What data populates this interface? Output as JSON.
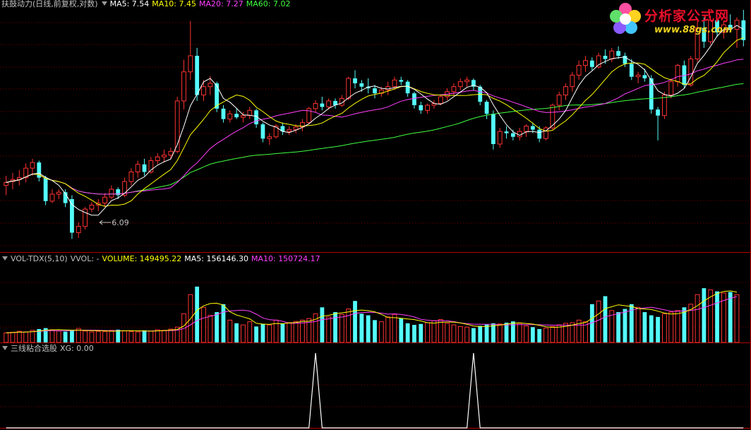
{
  "panels": {
    "main": {
      "title": "扶鼓动力(日线,前复权,对数)",
      "indicators": [
        {
          "label": "MA5: 7.54",
          "color": "#ffffff"
        },
        {
          "label": "MA10: 7.45",
          "color": "#ffff00"
        },
        {
          "label": "MA20: 7.27",
          "color": "#ff40ff"
        },
        {
          "label": "MA60: 7.02",
          "color": "#40ff40"
        }
      ]
    },
    "volume": {
      "title": "VOL-TDX(5,10)",
      "indicators": [
        {
          "label": "VVOL: -",
          "color": "#c0c0c0"
        },
        {
          "label": "VOLUME: 149495.22",
          "color": "#ffff00"
        },
        {
          "label": "MA5: 156146.30",
          "color": "#ffffff"
        },
        {
          "label": "MA10: 150724.17",
          "color": "#ff40ff"
        }
      ]
    },
    "signal": {
      "title": "三线粘合选股",
      "indicators": [
        {
          "label": "XG: 0.00",
          "color": "#c0c0c0"
        }
      ]
    }
  },
  "logo": {
    "brand": "分析家公式网",
    "url": "www.88gs.com"
  },
  "colors": {
    "up": "#ff3232",
    "down": "#54fcfc",
    "ma5": "#ffffff",
    "ma10": "#ffff00",
    "ma20": "#ff40ff",
    "ma60": "#40ff40",
    "grid": "#7a0000"
  },
  "chart_data": {
    "type": "candlestick",
    "annotation": {
      "text": "6.09",
      "candle_index": 14
    },
    "price_range": [
      6.0,
      8.7
    ],
    "candles": [
      {
        "o": 6.62,
        "h": 6.72,
        "l": 6.52,
        "c": 6.65
      },
      {
        "o": 6.66,
        "h": 6.75,
        "l": 6.58,
        "c": 6.68
      },
      {
        "o": 6.68,
        "h": 6.78,
        "l": 6.62,
        "c": 6.7
      },
      {
        "o": 6.7,
        "h": 6.85,
        "l": 6.65,
        "c": 6.8
      },
      {
        "o": 6.8,
        "h": 6.9,
        "l": 6.72,
        "c": 6.86
      },
      {
        "o": 6.86,
        "h": 6.88,
        "l": 6.66,
        "c": 6.7
      },
      {
        "o": 6.7,
        "h": 6.72,
        "l": 6.42,
        "c": 6.46
      },
      {
        "o": 6.46,
        "h": 6.58,
        "l": 6.44,
        "c": 6.53
      },
      {
        "o": 6.53,
        "h": 6.58,
        "l": 6.48,
        "c": 6.55
      },
      {
        "o": 6.55,
        "h": 6.58,
        "l": 6.4,
        "c": 6.44
      },
      {
        "o": 6.48,
        "h": 6.52,
        "l": 6.09,
        "c": 6.15
      },
      {
        "o": 6.15,
        "h": 6.25,
        "l": 6.1,
        "c": 6.21
      },
      {
        "o": 6.21,
        "h": 6.4,
        "l": 6.18,
        "c": 6.38
      },
      {
        "o": 6.38,
        "h": 6.45,
        "l": 6.35,
        "c": 6.42
      },
      {
        "o": 6.42,
        "h": 6.48,
        "l": 6.36,
        "c": 6.44
      },
      {
        "o": 6.44,
        "h": 6.54,
        "l": 6.4,
        "c": 6.5
      },
      {
        "o": 6.5,
        "h": 6.62,
        "l": 6.48,
        "c": 6.58
      },
      {
        "o": 6.58,
        "h": 6.6,
        "l": 6.48,
        "c": 6.52
      },
      {
        "o": 6.52,
        "h": 6.7,
        "l": 6.5,
        "c": 6.66
      },
      {
        "o": 6.66,
        "h": 6.8,
        "l": 6.62,
        "c": 6.76
      },
      {
        "o": 6.76,
        "h": 6.88,
        "l": 6.7,
        "c": 6.84
      },
      {
        "o": 6.84,
        "h": 6.9,
        "l": 6.72,
        "c": 6.76
      },
      {
        "o": 6.76,
        "h": 6.92,
        "l": 6.74,
        "c": 6.88
      },
      {
        "o": 6.88,
        "h": 6.96,
        "l": 6.84,
        "c": 6.92
      },
      {
        "o": 6.92,
        "h": 7.0,
        "l": 6.86,
        "c": 6.94
      },
      {
        "o": 6.94,
        "h": 7.02,
        "l": 6.9,
        "c": 6.98
      },
      {
        "o": 6.98,
        "h": 7.6,
        "l": 6.96,
        "c": 7.55
      },
      {
        "o": 7.55,
        "h": 8.05,
        "l": 7.45,
        "c": 7.9
      },
      {
        "o": 7.9,
        "h": 8.55,
        "l": 7.8,
        "c": 8.1
      },
      {
        "o": 8.1,
        "h": 8.2,
        "l": 7.55,
        "c": 7.62
      },
      {
        "o": 7.62,
        "h": 7.8,
        "l": 7.55,
        "c": 7.72
      },
      {
        "o": 7.72,
        "h": 7.85,
        "l": 7.62,
        "c": 7.76
      },
      {
        "o": 7.76,
        "h": 7.78,
        "l": 7.42,
        "c": 7.46
      },
      {
        "o": 7.46,
        "h": 7.5,
        "l": 7.3,
        "c": 7.34
      },
      {
        "o": 7.34,
        "h": 7.44,
        "l": 7.3,
        "c": 7.4
      },
      {
        "o": 7.4,
        "h": 7.46,
        "l": 7.34,
        "c": 7.36
      },
      {
        "o": 7.36,
        "h": 7.42,
        "l": 7.3,
        "c": 7.38
      },
      {
        "o": 7.38,
        "h": 7.48,
        "l": 7.34,
        "c": 7.44
      },
      {
        "o": 7.44,
        "h": 7.46,
        "l": 7.24,
        "c": 7.28
      },
      {
        "o": 7.28,
        "h": 7.3,
        "l": 7.08,
        "c": 7.12
      },
      {
        "o": 7.12,
        "h": 7.18,
        "l": 7.05,
        "c": 7.14
      },
      {
        "o": 7.14,
        "h": 7.28,
        "l": 7.12,
        "c": 7.26
      },
      {
        "o": 7.26,
        "h": 7.3,
        "l": 7.16,
        "c": 7.2
      },
      {
        "o": 7.2,
        "h": 7.26,
        "l": 7.16,
        "c": 7.22
      },
      {
        "o": 7.22,
        "h": 7.28,
        "l": 7.18,
        "c": 7.25
      },
      {
        "o": 7.25,
        "h": 7.34,
        "l": 7.2,
        "c": 7.3
      },
      {
        "o": 7.3,
        "h": 7.48,
        "l": 7.28,
        "c": 7.46
      },
      {
        "o": 7.46,
        "h": 7.56,
        "l": 7.42,
        "c": 7.52
      },
      {
        "o": 7.52,
        "h": 7.6,
        "l": 7.44,
        "c": 7.48
      },
      {
        "o": 7.48,
        "h": 7.58,
        "l": 7.45,
        "c": 7.55
      },
      {
        "o": 7.55,
        "h": 7.58,
        "l": 7.46,
        "c": 7.5
      },
      {
        "o": 7.5,
        "h": 7.62,
        "l": 7.48,
        "c": 7.58
      },
      {
        "o": 7.58,
        "h": 7.84,
        "l": 7.56,
        "c": 7.82
      },
      {
        "o": 7.82,
        "h": 7.92,
        "l": 7.7,
        "c": 7.76
      },
      {
        "o": 7.76,
        "h": 7.8,
        "l": 7.66,
        "c": 7.72
      },
      {
        "o": 7.72,
        "h": 7.82,
        "l": 7.64,
        "c": 7.7
      },
      {
        "o": 7.7,
        "h": 7.74,
        "l": 7.58,
        "c": 7.64
      },
      {
        "o": 7.64,
        "h": 7.72,
        "l": 7.6,
        "c": 7.68
      },
      {
        "o": 7.68,
        "h": 7.78,
        "l": 7.62,
        "c": 7.72
      },
      {
        "o": 7.72,
        "h": 7.84,
        "l": 7.68,
        "c": 7.8
      },
      {
        "o": 7.8,
        "h": 7.84,
        "l": 7.74,
        "c": 7.78
      },
      {
        "o": 7.78,
        "h": 7.8,
        "l": 7.6,
        "c": 7.64
      },
      {
        "o": 7.64,
        "h": 7.66,
        "l": 7.46,
        "c": 7.5
      },
      {
        "o": 7.5,
        "h": 7.54,
        "l": 7.4,
        "c": 7.44
      },
      {
        "o": 7.44,
        "h": 7.52,
        "l": 7.4,
        "c": 7.5
      },
      {
        "o": 7.5,
        "h": 7.56,
        "l": 7.46,
        "c": 7.52
      },
      {
        "o": 7.52,
        "h": 7.62,
        "l": 7.5,
        "c": 7.6
      },
      {
        "o": 7.6,
        "h": 7.7,
        "l": 7.56,
        "c": 7.66
      },
      {
        "o": 7.66,
        "h": 7.76,
        "l": 7.62,
        "c": 7.72
      },
      {
        "o": 7.72,
        "h": 7.82,
        "l": 7.68,
        "c": 7.78
      },
      {
        "o": 7.78,
        "h": 7.84,
        "l": 7.72,
        "c": 7.8
      },
      {
        "o": 7.8,
        "h": 7.82,
        "l": 7.68,
        "c": 7.72
      },
      {
        "o": 7.72,
        "h": 7.74,
        "l": 7.5,
        "c": 7.54
      },
      {
        "o": 7.54,
        "h": 7.56,
        "l": 7.34,
        "c": 7.4
      },
      {
        "o": 7.4,
        "h": 7.44,
        "l": 7.0,
        "c": 7.06
      },
      {
        "o": 7.06,
        "h": 7.24,
        "l": 7.02,
        "c": 7.2
      },
      {
        "o": 7.2,
        "h": 7.26,
        "l": 7.12,
        "c": 7.18
      },
      {
        "o": 7.18,
        "h": 7.22,
        "l": 7.1,
        "c": 7.14
      },
      {
        "o": 7.14,
        "h": 7.24,
        "l": 7.1,
        "c": 7.2
      },
      {
        "o": 7.2,
        "h": 7.28,
        "l": 7.14,
        "c": 7.26
      },
      {
        "o": 7.26,
        "h": 7.3,
        "l": 7.18,
        "c": 7.22
      },
      {
        "o": 7.22,
        "h": 7.26,
        "l": 7.08,
        "c": 7.12
      },
      {
        "o": 7.12,
        "h": 7.26,
        "l": 7.1,
        "c": 7.24
      },
      {
        "o": 7.24,
        "h": 7.52,
        "l": 7.22,
        "c": 7.5
      },
      {
        "o": 7.5,
        "h": 7.66,
        "l": 7.44,
        "c": 7.62
      },
      {
        "o": 7.62,
        "h": 7.76,
        "l": 7.56,
        "c": 7.72
      },
      {
        "o": 7.72,
        "h": 7.9,
        "l": 7.66,
        "c": 7.86
      },
      {
        "o": 7.86,
        "h": 8.04,
        "l": 7.8,
        "c": 7.98
      },
      {
        "o": 7.98,
        "h": 8.1,
        "l": 7.9,
        "c": 8.04
      },
      {
        "o": 8.04,
        "h": 8.08,
        "l": 7.92,
        "c": 7.96
      },
      {
        "o": 7.96,
        "h": 8.14,
        "l": 7.94,
        "c": 8.1
      },
      {
        "o": 8.1,
        "h": 8.18,
        "l": 8.0,
        "c": 8.06
      },
      {
        "o": 8.06,
        "h": 8.2,
        "l": 8.02,
        "c": 8.16
      },
      {
        "o": 8.16,
        "h": 8.22,
        "l": 8.06,
        "c": 8.1
      },
      {
        "o": 8.1,
        "h": 8.14,
        "l": 7.96,
        "c": 8.0
      },
      {
        "o": 8.0,
        "h": 8.06,
        "l": 7.8,
        "c": 7.84
      },
      {
        "o": 7.84,
        "h": 7.9,
        "l": 7.76,
        "c": 7.86
      },
      {
        "o": 7.86,
        "h": 7.94,
        "l": 7.78,
        "c": 7.82
      },
      {
        "o": 7.82,
        "h": 7.86,
        "l": 7.4,
        "c": 7.45
      },
      {
        "o": 7.45,
        "h": 7.48,
        "l": 7.1,
        "c": 7.38
      },
      {
        "o": 7.38,
        "h": 7.66,
        "l": 7.34,
        "c": 7.62
      },
      {
        "o": 7.62,
        "h": 7.82,
        "l": 7.58,
        "c": 7.78
      },
      {
        "o": 7.78,
        "h": 8.0,
        "l": 7.72,
        "c": 7.98
      },
      {
        "o": 7.98,
        "h": 8.04,
        "l": 7.7,
        "c": 7.74
      },
      {
        "o": 7.74,
        "h": 8.1,
        "l": 7.72,
        "c": 8.06
      },
      {
        "o": 8.06,
        "h": 8.55,
        "l": 8.02,
        "c": 8.46
      },
      {
        "o": 8.46,
        "h": 8.6,
        "l": 8.2,
        "c": 8.28
      },
      {
        "o": 8.28,
        "h": 8.62,
        "l": 8.24,
        "c": 8.56
      },
      {
        "o": 8.56,
        "h": 8.66,
        "l": 8.34,
        "c": 8.4
      },
      {
        "o": 8.4,
        "h": 8.56,
        "l": 8.32,
        "c": 8.5
      },
      {
        "o": 8.5,
        "h": 8.64,
        "l": 8.42,
        "c": 8.44
      },
      {
        "o": 8.44,
        "h": 8.6,
        "l": 8.2,
        "c": 8.56
      },
      {
        "o": 8.56,
        "h": 8.7,
        "l": 8.22,
        "c": 8.3
      }
    ],
    "volume_range": [
      0,
      250000
    ],
    "volumes": [
      30000,
      32000,
      35000,
      33000,
      38000,
      42000,
      45000,
      40000,
      36000,
      34000,
      38000,
      44000,
      36000,
      33000,
      35000,
      34000,
      38000,
      40000,
      36000,
      34000,
      33000,
      38000,
      36000,
      40000,
      38000,
      42000,
      48000,
      90000,
      150000,
      175000,
      110000,
      85000,
      95000,
      120000,
      70000,
      60000,
      55000,
      65000,
      50000,
      58000,
      55000,
      70000,
      60000,
      62000,
      66000,
      70000,
      75000,
      90000,
      110000,
      80000,
      95000,
      88000,
      105000,
      130000,
      90000,
      85000,
      70000,
      65000,
      80000,
      88000,
      75000,
      60000,
      55000,
      58000,
      62000,
      68000,
      72000,
      60000,
      55000,
      50000,
      48000,
      45000,
      52000,
      56000,
      60000,
      58000,
      62000,
      66000,
      60000,
      52000,
      48000,
      42000,
      45000,
      50000,
      55000,
      60000,
      62000,
      70000,
      65000,
      120000,
      130000,
      145000,
      100000,
      95000,
      105000,
      120000,
      110000,
      95000,
      85000,
      80000,
      90000,
      95000,
      100000,
      110000,
      120000,
      150000,
      170000,
      165000,
      160000,
      155000,
      158000,
      149495
    ],
    "signal": {
      "values_peak_at": [
        47,
        71
      ],
      "ylim": [
        0,
        1
      ],
      "current": 0.0
    }
  }
}
